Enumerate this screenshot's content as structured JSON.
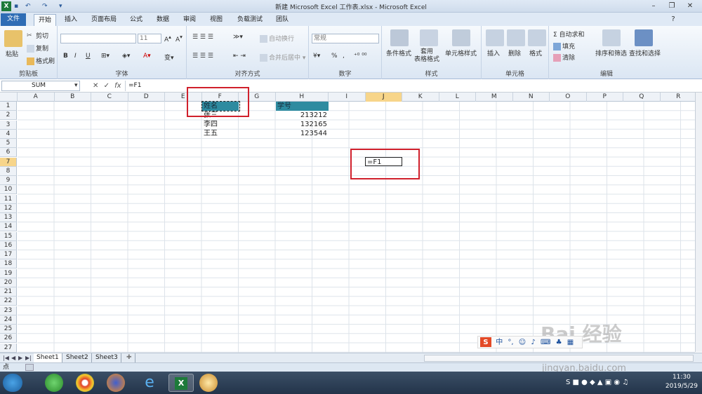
{
  "window": {
    "title": "新建 Microsoft Excel 工作表.xlsx - Microsoft Excel"
  },
  "ribbon": {
    "tabs": [
      "文件",
      "开始",
      "插入",
      "页面布局",
      "公式",
      "数据",
      "审阅",
      "视图",
      "负载测试",
      "团队"
    ],
    "clipboard": {
      "cut": "剪切",
      "copy": "复制",
      "paste": "粘贴",
      "format_painter": "格式刷",
      "group": "剪贴板"
    },
    "font": {
      "size": "11",
      "group": "字体",
      "bold": "B",
      "italic": "I",
      "underline": "U"
    },
    "alignment": {
      "wrap": "自动换行",
      "merge": "合并后居中",
      "group": "对齐方式"
    },
    "number": {
      "format": "常规",
      "percent": "%",
      "comma": ",",
      "group": "数字"
    },
    "styles": {
      "conditional": "条件格式",
      "table": "套用\n表格格式",
      "cell_style": "单元格样式",
      "group": "样式"
    },
    "cells": {
      "insert": "插入",
      "delete": "删除",
      "format": "格式",
      "group": "单元格"
    },
    "editing": {
      "autosum": "Σ 自动求和",
      "fill": "填充",
      "clear": "清除",
      "sort": "排序和筛选",
      "find": "查找和选择",
      "group": "编辑"
    }
  },
  "formula_bar": {
    "name_box": "SUM",
    "fx": "fx",
    "formula": "=F1"
  },
  "columns": [
    "A",
    "B",
    "C",
    "D",
    "E",
    "F",
    "G",
    "H",
    "I",
    "J",
    "K",
    "L",
    "M",
    "N",
    "O",
    "P",
    "Q",
    "R"
  ],
  "rows": [
    "1",
    "2",
    "3",
    "4",
    "5",
    "6",
    "7",
    "8",
    "9",
    "10",
    "11",
    "12",
    "13",
    "14",
    "15",
    "16",
    "17",
    "18",
    "19",
    "20",
    "21",
    "22",
    "23",
    "24",
    "25",
    "26",
    "27"
  ],
  "cells": {
    "F1": "姓名",
    "H1": "学号",
    "F2": "张三",
    "F3": "李四",
    "F4": "王五",
    "H2": "213212",
    "H3": "132165",
    "H4": "123544",
    "J7": "=F1"
  },
  "sheets": [
    "Sheet1",
    "Sheet2",
    "Sheet3"
  ],
  "status": {
    "mode": "点"
  },
  "ime": {
    "label": "中"
  },
  "watermark": {
    "logo": "Bai 经验",
    "url": "jingyan.baidu.com"
  },
  "taskbar": {
    "time": "11:30",
    "date": "2019/5/29"
  },
  "colors": {
    "header_fill": "#2e8ba0",
    "highlight_box": "#d0202c",
    "file_tab": "#2f6db5"
  }
}
